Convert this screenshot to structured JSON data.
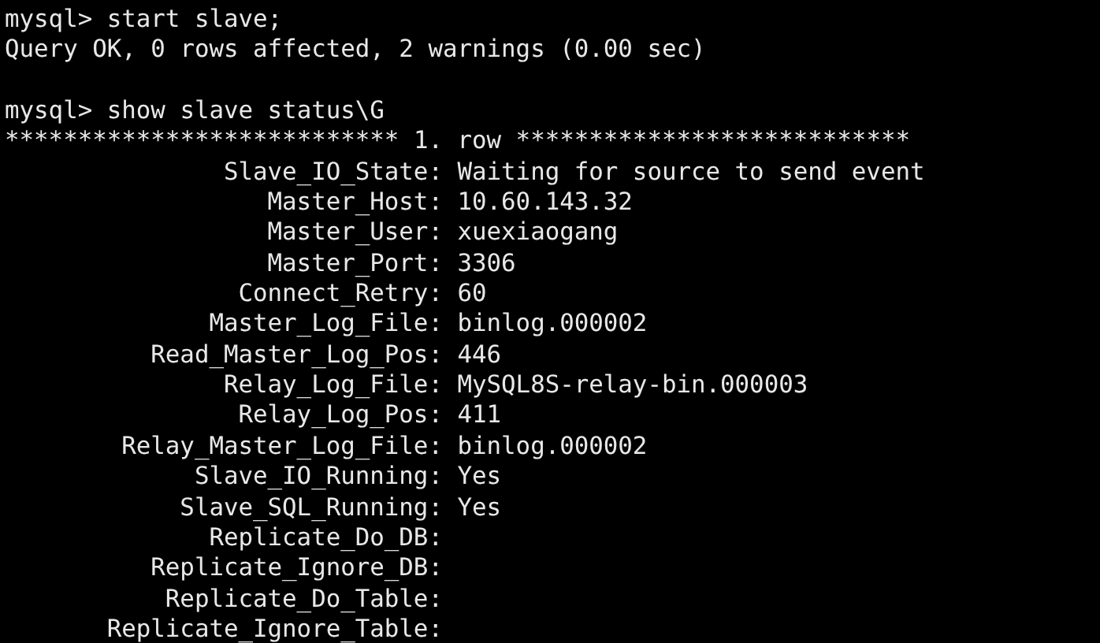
{
  "terminal": {
    "lines": [
      {
        "kind": "text",
        "text": "mysql> start slave;"
      },
      {
        "kind": "text",
        "text": "Query OK, 0 rows affected, 2 warnings (0.00 sec)"
      },
      {
        "kind": "gap"
      },
      {
        "kind": "text",
        "text": "mysql> show slave status\\G"
      },
      {
        "kind": "text",
        "text": "*************************** 1. row ***************************"
      },
      {
        "kind": "field",
        "label": "Slave_IO_State:",
        "value": "Waiting for source to send event"
      },
      {
        "kind": "field",
        "label": "Master_Host:",
        "value": "10.60.143.32"
      },
      {
        "kind": "field",
        "label": "Master_User:",
        "value": "xuexiaogang"
      },
      {
        "kind": "field",
        "label": "Master_Port:",
        "value": "3306"
      },
      {
        "kind": "field",
        "label": "Connect_Retry:",
        "value": "60"
      },
      {
        "kind": "field",
        "label": "Master_Log_File:",
        "value": "binlog.000002"
      },
      {
        "kind": "field",
        "label": "Read_Master_Log_Pos:",
        "value": "446"
      },
      {
        "kind": "field",
        "label": "Relay_Log_File:",
        "value": "MySQL8S-relay-bin.000003"
      },
      {
        "kind": "field",
        "label": "Relay_Log_Pos:",
        "value": "411"
      },
      {
        "kind": "field",
        "label": "Relay_Master_Log_File:",
        "value": "binlog.000002"
      },
      {
        "kind": "field",
        "label": "Slave_IO_Running:",
        "value": "Yes"
      },
      {
        "kind": "field",
        "label": "Slave_SQL_Running:",
        "value": "Yes"
      },
      {
        "kind": "field",
        "label": "Replicate_Do_DB:"
      },
      {
        "kind": "field",
        "label": "Replicate_Ignore_DB:"
      },
      {
        "kind": "field",
        "label": "Replicate_Do_Table:"
      },
      {
        "kind": "field",
        "label": "Replicate_Ignore_Table:"
      }
    ]
  }
}
